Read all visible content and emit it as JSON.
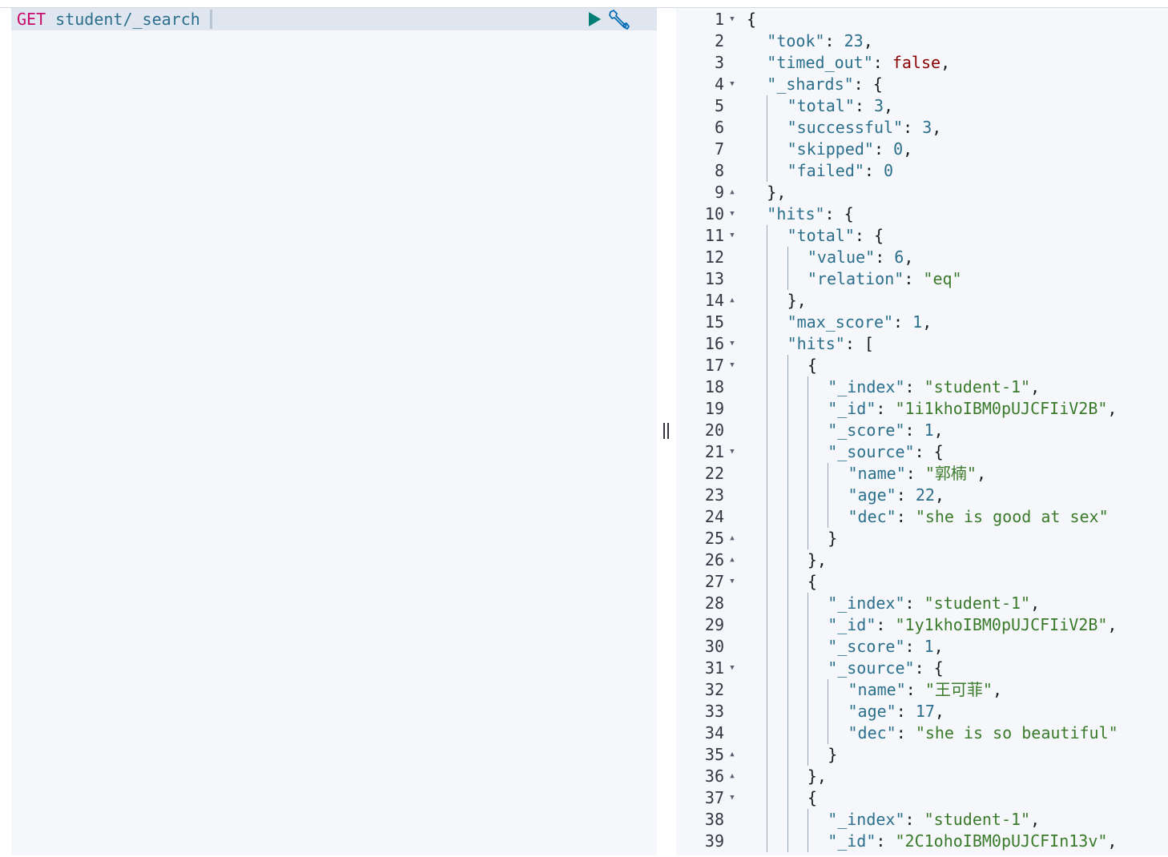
{
  "request": {
    "method": "GET",
    "path": "student/_search"
  },
  "icons": {
    "run": "play-icon",
    "settings": "wrench-icon",
    "splitter": "resize-grip-icon",
    "fold_open": "caret-down-icon",
    "fold_close": "caret-up-icon"
  },
  "colors": {
    "method": "#c80a68",
    "key": "#2b6f8c",
    "string": "#3a7a2b",
    "number": "#2b6f8c",
    "boolean": "#8b0000",
    "run_button": "#017d73",
    "wrench": "#006bb4"
  },
  "response": {
    "lines": [
      {
        "n": "1",
        "fold": "down",
        "indent": 0,
        "tokens": [
          [
            "p",
            "{"
          ]
        ]
      },
      {
        "n": "2",
        "fold": "",
        "indent": 1,
        "tokens": [
          [
            "k",
            "\"took\""
          ],
          [
            "p",
            ": "
          ],
          [
            "n",
            "23"
          ],
          [
            "p",
            ","
          ]
        ]
      },
      {
        "n": "3",
        "fold": "",
        "indent": 1,
        "tokens": [
          [
            "k",
            "\"timed_out\""
          ],
          [
            "p",
            ": "
          ],
          [
            "b",
            "false"
          ],
          [
            "p",
            ","
          ]
        ]
      },
      {
        "n": "4",
        "fold": "down",
        "indent": 1,
        "tokens": [
          [
            "k",
            "\"_shards\""
          ],
          [
            "p",
            ": {"
          ]
        ]
      },
      {
        "n": "5",
        "fold": "",
        "indent": 2,
        "tokens": [
          [
            "k",
            "\"total\""
          ],
          [
            "p",
            ": "
          ],
          [
            "n",
            "3"
          ],
          [
            "p",
            ","
          ]
        ]
      },
      {
        "n": "6",
        "fold": "",
        "indent": 2,
        "tokens": [
          [
            "k",
            "\"successful\""
          ],
          [
            "p",
            ": "
          ],
          [
            "n",
            "3"
          ],
          [
            "p",
            ","
          ]
        ]
      },
      {
        "n": "7",
        "fold": "",
        "indent": 2,
        "tokens": [
          [
            "k",
            "\"skipped\""
          ],
          [
            "p",
            ": "
          ],
          [
            "n",
            "0"
          ],
          [
            "p",
            ","
          ]
        ]
      },
      {
        "n": "8",
        "fold": "",
        "indent": 2,
        "tokens": [
          [
            "k",
            "\"failed\""
          ],
          [
            "p",
            ": "
          ],
          [
            "n",
            "0"
          ]
        ]
      },
      {
        "n": "9",
        "fold": "up",
        "indent": 1,
        "tokens": [
          [
            "p",
            "},"
          ]
        ]
      },
      {
        "n": "10",
        "fold": "down",
        "indent": 1,
        "tokens": [
          [
            "k",
            "\"hits\""
          ],
          [
            "p",
            ": {"
          ]
        ]
      },
      {
        "n": "11",
        "fold": "down",
        "indent": 2,
        "tokens": [
          [
            "k",
            "\"total\""
          ],
          [
            "p",
            ": {"
          ]
        ]
      },
      {
        "n": "12",
        "fold": "",
        "indent": 3,
        "tokens": [
          [
            "k",
            "\"value\""
          ],
          [
            "p",
            ": "
          ],
          [
            "n",
            "6"
          ],
          [
            "p",
            ","
          ]
        ]
      },
      {
        "n": "13",
        "fold": "",
        "indent": 3,
        "tokens": [
          [
            "k",
            "\"relation\""
          ],
          [
            "p",
            ": "
          ],
          [
            "s",
            "\"eq\""
          ]
        ]
      },
      {
        "n": "14",
        "fold": "up",
        "indent": 2,
        "tokens": [
          [
            "p",
            "},"
          ]
        ]
      },
      {
        "n": "15",
        "fold": "",
        "indent": 2,
        "tokens": [
          [
            "k",
            "\"max_score\""
          ],
          [
            "p",
            ": "
          ],
          [
            "n",
            "1"
          ],
          [
            "p",
            ","
          ]
        ]
      },
      {
        "n": "16",
        "fold": "down",
        "indent": 2,
        "tokens": [
          [
            "k",
            "\"hits\""
          ],
          [
            "p",
            ": ["
          ]
        ]
      },
      {
        "n": "17",
        "fold": "down",
        "indent": 3,
        "tokens": [
          [
            "p",
            "{"
          ]
        ]
      },
      {
        "n": "18",
        "fold": "",
        "indent": 4,
        "tokens": [
          [
            "k",
            "\"_index\""
          ],
          [
            "p",
            ": "
          ],
          [
            "s",
            "\"student-1\""
          ],
          [
            "p",
            ","
          ]
        ]
      },
      {
        "n": "19",
        "fold": "",
        "indent": 4,
        "tokens": [
          [
            "k",
            "\"_id\""
          ],
          [
            "p",
            ": "
          ],
          [
            "s",
            "\"1i1khoIBM0pUJCFIiV2B\""
          ],
          [
            "p",
            ","
          ]
        ]
      },
      {
        "n": "20",
        "fold": "",
        "indent": 4,
        "tokens": [
          [
            "k",
            "\"_score\""
          ],
          [
            "p",
            ": "
          ],
          [
            "n",
            "1"
          ],
          [
            "p",
            ","
          ]
        ]
      },
      {
        "n": "21",
        "fold": "down",
        "indent": 4,
        "tokens": [
          [
            "k",
            "\"_source\""
          ],
          [
            "p",
            ": {"
          ]
        ]
      },
      {
        "n": "22",
        "fold": "",
        "indent": 5,
        "tokens": [
          [
            "k",
            "\"name\""
          ],
          [
            "p",
            ": "
          ],
          [
            "s",
            "\"郭楠\""
          ],
          [
            "p",
            ","
          ]
        ]
      },
      {
        "n": "23",
        "fold": "",
        "indent": 5,
        "tokens": [
          [
            "k",
            "\"age\""
          ],
          [
            "p",
            ": "
          ],
          [
            "n",
            "22"
          ],
          [
            "p",
            ","
          ]
        ]
      },
      {
        "n": "24",
        "fold": "",
        "indent": 5,
        "tokens": [
          [
            "k",
            "\"dec\""
          ],
          [
            "p",
            ": "
          ],
          [
            "s",
            "\"she is good at sex\""
          ]
        ]
      },
      {
        "n": "25",
        "fold": "up",
        "indent": 4,
        "tokens": [
          [
            "p",
            "}"
          ]
        ]
      },
      {
        "n": "26",
        "fold": "up",
        "indent": 3,
        "tokens": [
          [
            "p",
            "},"
          ]
        ]
      },
      {
        "n": "27",
        "fold": "down",
        "indent": 3,
        "tokens": [
          [
            "p",
            "{"
          ]
        ]
      },
      {
        "n": "28",
        "fold": "",
        "indent": 4,
        "tokens": [
          [
            "k",
            "\"_index\""
          ],
          [
            "p",
            ": "
          ],
          [
            "s",
            "\"student-1\""
          ],
          [
            "p",
            ","
          ]
        ]
      },
      {
        "n": "29",
        "fold": "",
        "indent": 4,
        "tokens": [
          [
            "k",
            "\"_id\""
          ],
          [
            "p",
            ": "
          ],
          [
            "s",
            "\"1y1khoIBM0pUJCFIiV2B\""
          ],
          [
            "p",
            ","
          ]
        ]
      },
      {
        "n": "30",
        "fold": "",
        "indent": 4,
        "tokens": [
          [
            "k",
            "\"_score\""
          ],
          [
            "p",
            ": "
          ],
          [
            "n",
            "1"
          ],
          [
            "p",
            ","
          ]
        ]
      },
      {
        "n": "31",
        "fold": "down",
        "indent": 4,
        "tokens": [
          [
            "k",
            "\"_source\""
          ],
          [
            "p",
            ": {"
          ]
        ]
      },
      {
        "n": "32",
        "fold": "",
        "indent": 5,
        "tokens": [
          [
            "k",
            "\"name\""
          ],
          [
            "p",
            ": "
          ],
          [
            "s",
            "\"王可菲\""
          ],
          [
            "p",
            ","
          ]
        ]
      },
      {
        "n": "33",
        "fold": "",
        "indent": 5,
        "tokens": [
          [
            "k",
            "\"age\""
          ],
          [
            "p",
            ": "
          ],
          [
            "n",
            "17"
          ],
          [
            "p",
            ","
          ]
        ]
      },
      {
        "n": "34",
        "fold": "",
        "indent": 5,
        "tokens": [
          [
            "k",
            "\"dec\""
          ],
          [
            "p",
            ": "
          ],
          [
            "s",
            "\"she is so beautiful\""
          ]
        ]
      },
      {
        "n": "35",
        "fold": "up",
        "indent": 4,
        "tokens": [
          [
            "p",
            "}"
          ]
        ]
      },
      {
        "n": "36",
        "fold": "up",
        "indent": 3,
        "tokens": [
          [
            "p",
            "},"
          ]
        ]
      },
      {
        "n": "37",
        "fold": "down",
        "indent": 3,
        "tokens": [
          [
            "p",
            "{"
          ]
        ]
      },
      {
        "n": "38",
        "fold": "",
        "indent": 4,
        "tokens": [
          [
            "k",
            "\"_index\""
          ],
          [
            "p",
            ": "
          ],
          [
            "s",
            "\"student-1\""
          ],
          [
            "p",
            ","
          ]
        ]
      },
      {
        "n": "39",
        "fold": "",
        "indent": 4,
        "tokens": [
          [
            "k",
            "\"_id\""
          ],
          [
            "p",
            ": "
          ],
          [
            "s",
            "\"2C1ohoIBM0pUJCFIn13v\""
          ],
          [
            "p",
            ","
          ]
        ]
      }
    ]
  }
}
